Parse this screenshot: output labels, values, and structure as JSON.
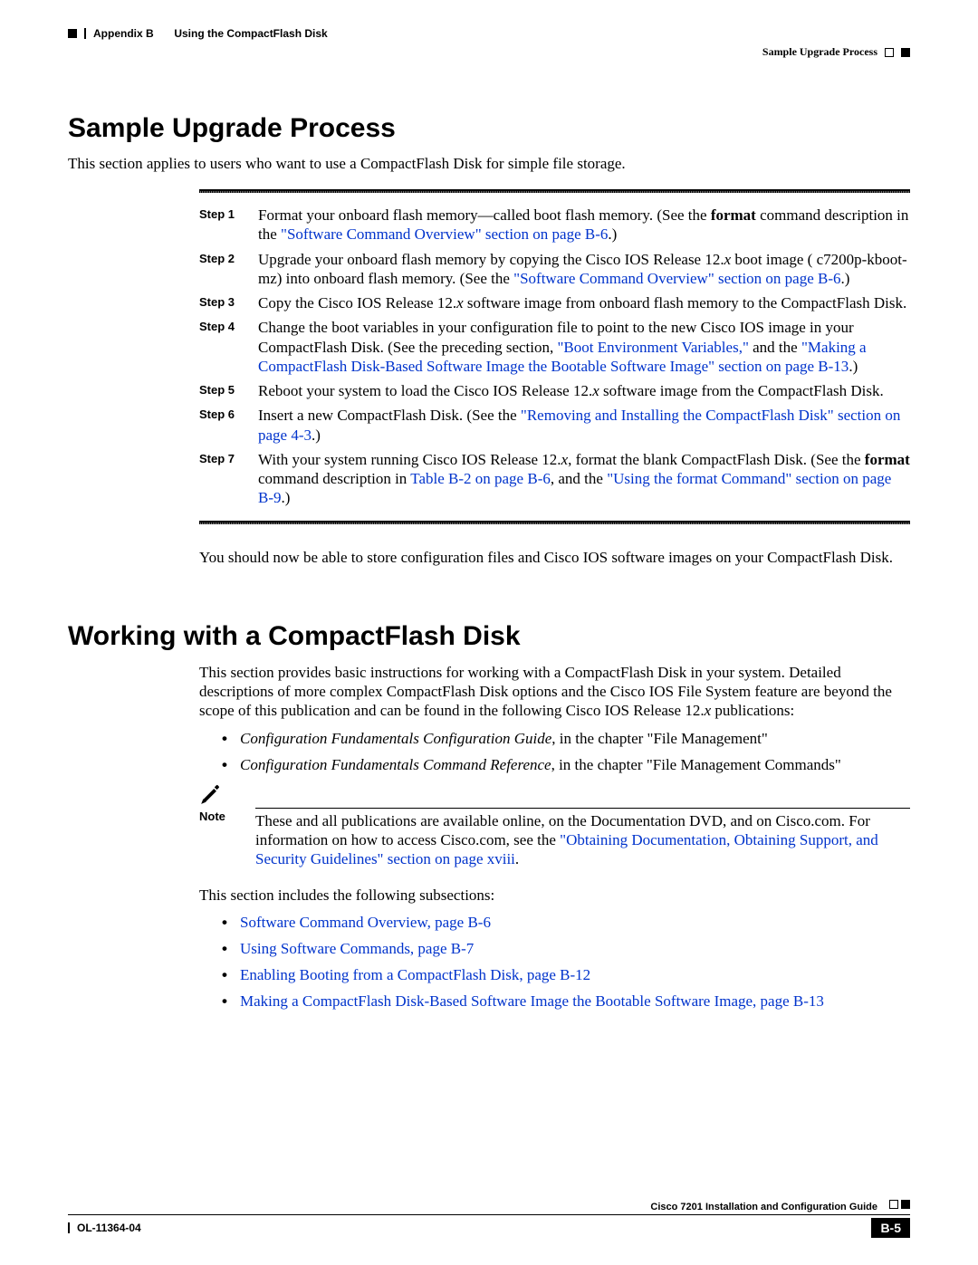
{
  "header": {
    "appendix": "Appendix B",
    "chapter": "Using the CompactFlash Disk",
    "section": "Sample Upgrade Process"
  },
  "section1": {
    "title": "Sample Upgrade Process",
    "intro": "This section applies to users who want to use a CompactFlash Disk for simple file storage.",
    "steps": [
      {
        "label": "Step 1",
        "pre": "Format your onboard flash memory—called boot flash memory. (See the ",
        "bold1": "format",
        "mid": " command description in the ",
        "link1": "\"Software Command Overview\" section on page B-6",
        "post": ".)"
      },
      {
        "label": "Step 2",
        "text1": "Upgrade your onboard flash memory by copying the Cisco IOS Release 12.",
        "ital1": "x",
        "text2": " boot image ( c7200p-kboot-mz) into onboard flash memory. (See the ",
        "link1": "\"Software Command Overview\" section on page B-6",
        "post": ".)"
      },
      {
        "label": "Step 3",
        "text1": "Copy the Cisco IOS Release 12.",
        "ital1": "x",
        "text2": " software image from onboard flash memory to the CompactFlash Disk."
      },
      {
        "label": "Step 4",
        "text1": "Change the boot variables in your configuration file to point to the new Cisco IOS image in your CompactFlash Disk. (See the preceding section, ",
        "link1": "\"Boot Environment Variables,\"",
        "text2": " and the ",
        "link2": "\"Making a CompactFlash Disk-Based Software Image the Bootable Software Image\" section on page B-13",
        "post": ".)"
      },
      {
        "label": "Step 5",
        "text1": "Reboot your system to load the Cisco IOS Release 12.",
        "ital1": "x",
        "text2": " software image from the CompactFlash Disk."
      },
      {
        "label": "Step 6",
        "text1": "Insert a new CompactFlash Disk. (See the ",
        "link1": "\"Removing and Installing the CompactFlash Disk\" section on page 4-3",
        "post": ".)"
      },
      {
        "label": "Step 7",
        "text1": "With your system running Cisco IOS Release 12.",
        "ital1": "x",
        "text2": ", format the blank CompactFlash Disk. (See the ",
        "bold1": "format",
        "text3": " command description in ",
        "link1": "Table B-2 on page B-6",
        "text4": ", and the ",
        "link2": "\"Using the format Command\" section on page B-9",
        "post": ".)"
      }
    ],
    "closing": "You should now be able to store configuration files and Cisco IOS software images on your CompactFlash Disk."
  },
  "section2": {
    "title": "Working with a CompactFlash Disk",
    "intro1": "This section provides basic instructions for working with a CompactFlash Disk in your system. Detailed descriptions of more complex CompactFlash Disk options and the Cisco IOS File System feature are beyond the scope of this publication and can be found in the following Cisco IOS Release 12.",
    "intro_ital": "x",
    "intro2": " publications:",
    "pubs": [
      {
        "ital": "Configuration Fundamentals Configuration Guide",
        "tail": ", in the chapter \"File Management\""
      },
      {
        "ital": "Configuration Fundamentals Command Reference",
        "tail": ", in the chapter \"File Management Commands\""
      }
    ],
    "note": {
      "label": "Note",
      "text1": "These and all publications are available online, on the Documentation DVD, and on Cisco.com. For information on how to access Cisco.com, see the ",
      "link1": "\"Obtaining Documentation, Obtaining Support, and Security Guidelines\" section on page xviii",
      "post": "."
    },
    "subs_intro": "This section includes the following subsections:",
    "subs": [
      "Software Command Overview, page B-6",
      "Using Software Commands, page B-7",
      "Enabling Booting from a CompactFlash Disk, page B-12",
      "Making a CompactFlash Disk-Based Software Image the Bootable Software Image, page B-13"
    ]
  },
  "footer": {
    "guide": "Cisco 7201 Installation and Configuration Guide",
    "docid": "OL-11364-04",
    "page": "B-5"
  }
}
